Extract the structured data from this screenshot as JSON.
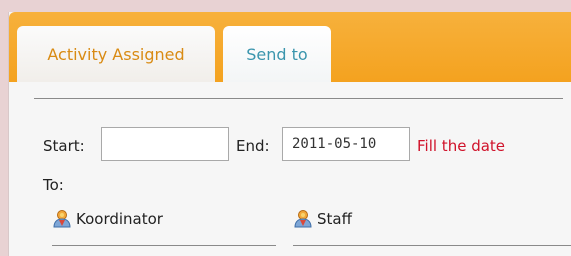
{
  "tabs": [
    {
      "label": "Activity Assigned"
    },
    {
      "label": "Send to"
    }
  ],
  "form": {
    "start_label": "Start:",
    "start_value": "",
    "end_label": "End:",
    "end_value": "2011-05-10",
    "warning": "Fill the date",
    "to_label": "To:"
  },
  "groups": [
    {
      "label": "Koordinator",
      "icon": "user-group-icon"
    },
    {
      "label": "Staff",
      "icon": "user-group-icon"
    }
  ],
  "colors": {
    "tabbar": "#f4a21f",
    "tab_active_text": "#d98b14",
    "tab_link_text": "#3a95ad",
    "warning": "#d0122a"
  }
}
